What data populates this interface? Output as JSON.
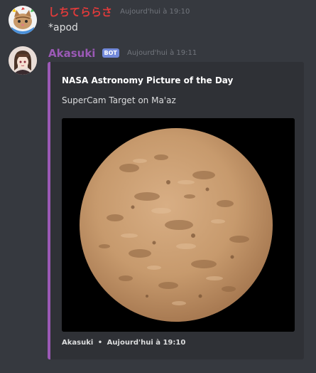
{
  "messages": [
    {
      "username": "しちてららさ",
      "username_color": "#e03b3b",
      "timestamp": "Aujourd'hui à 19:10",
      "content": "*apod"
    },
    {
      "username": "Akasuki",
      "username_color": "#9b59b6",
      "bot_badge": "BOT",
      "timestamp": "Aujourd'hui à 19:11",
      "embed": {
        "accent_color": "#9b59b6",
        "title": "NASA Astronomy Picture of the Day",
        "description": "SuperCam Target on Ma'az",
        "footer_author": "Akasuki",
        "footer_separator": "•",
        "footer_time": "Aujourd'hui à 19:10"
      }
    }
  ]
}
